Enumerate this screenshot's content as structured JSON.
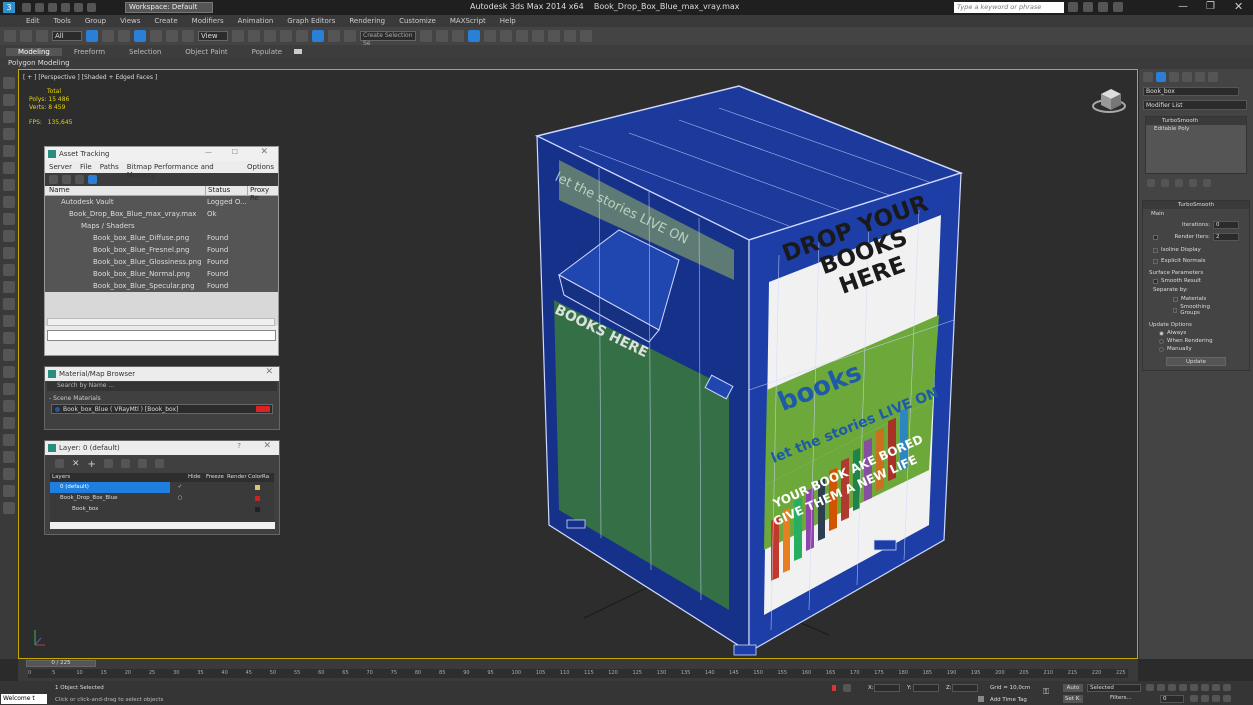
{
  "title": {
    "app": "Autodesk 3ds Max  2014 x64",
    "file": "Book_Drop_Box_Blue_max_vray.max",
    "workspace": "Workspace: Default",
    "search_placeholder": "Type a keyword or phrase"
  },
  "menu": [
    "Edit",
    "Tools",
    "Group",
    "Views",
    "Create",
    "Modifiers",
    "Animation",
    "Graph Editors",
    "Rendering",
    "Customize",
    "MAXScript",
    "Help"
  ],
  "toolbar": {
    "filter": "All",
    "view": "View",
    "selection_set": "Create Selection Se"
  },
  "ribbon": {
    "tabs": [
      "Modeling",
      "Freeform",
      "Selection",
      "Object Paint",
      "Populate"
    ],
    "sub": "Polygon Modeling"
  },
  "viewport": {
    "label": "[ + ] [Perspective ] [Shaded + Edged Faces ]",
    "stats": {
      "total": "Total",
      "polys_label": "Polys:",
      "polys": "15 486",
      "verts_label": "Verts:",
      "verts": "8 459",
      "fps_label": "FPS:",
      "fps": "135,645"
    },
    "sign": {
      "headline1": "DROP YOUR",
      "headline2": "BOOKS HERE",
      "brand": "books",
      "tag1": "let the stories LIVE ON",
      "tag2": "YOUR BOOK AKE BORED",
      "tag3": "GIVE THEM A NEW LIFE",
      "side1": "let the stories LIVE ON",
      "side2": "BOOKS HERE"
    }
  },
  "asset_tracking": {
    "title": "Asset Tracking",
    "menu": [
      "Server",
      "File",
      "Paths",
      "Bitmap Performance and Memory",
      "Options"
    ],
    "columns": [
      "Name",
      "Status",
      "Proxy Re"
    ],
    "rows": [
      {
        "name": "Autodesk Vault",
        "status": "Logged O..."
      },
      {
        "name": "Book_Drop_Box_Blue_max_vray.max",
        "status": "Ok"
      },
      {
        "name": "Maps / Shaders",
        "status": ""
      },
      {
        "name": "Book_box_Blue_Diffuse.png",
        "status": "Found"
      },
      {
        "name": "Book_box_Blue_Fresnel.png",
        "status": "Found"
      },
      {
        "name": "Book_box_Blue_Glossiness.png",
        "status": "Found"
      },
      {
        "name": "Book_box_Blue_Normal.png",
        "status": "Found"
      },
      {
        "name": "Book_box_Blue_Specular.png",
        "status": "Found"
      }
    ]
  },
  "material_browser": {
    "title": "Material/Map Browser",
    "search": "Search by Name ...",
    "group": "- Scene Materials",
    "item": "Book_box_Blue ( VRayMtl ) [Book_box]"
  },
  "layer_panel": {
    "title": "Layer: 0 (default)",
    "columns": [
      "Layers",
      "Hide",
      "Freeze",
      "Render",
      "Color",
      "Ra"
    ],
    "rows": [
      "0 (default)",
      "Book_Drop_Box_Blue",
      "Book_box"
    ]
  },
  "command_panel": {
    "object_name": "Book_box",
    "modifier_list": "Modifier List",
    "stack": [
      "TurboSmooth",
      "Editable Poly"
    ],
    "rollout": "TurboSmooth",
    "main": "Main",
    "iterations_label": "Iterations:",
    "iterations": "0",
    "render_iters_label": "Render Iters:",
    "render_iters": "2",
    "isoline": "Isoline Display",
    "explicit": "Explicit Normals",
    "surface": "Surface Parameters",
    "smooth": "Smooth Result",
    "separate": "Separate by:",
    "materials": "Materials",
    "smoothing_groups": "Smoothing Groups",
    "update_options": "Update Options",
    "always": "Always",
    "when_rendering": "When Rendering",
    "manually": "Manually",
    "update": "Update"
  },
  "timeline": {
    "frame": "0 / 225",
    "ticks": [
      "0",
      "5",
      "10",
      "15",
      "20",
      "25",
      "30",
      "35",
      "40",
      "45",
      "50",
      "55",
      "60",
      "65",
      "70",
      "75",
      "80",
      "85",
      "90",
      "95",
      "100",
      "105",
      "110",
      "115",
      "120",
      "125",
      "130",
      "135",
      "140",
      "145",
      "150",
      "155",
      "160",
      "165",
      "170",
      "175",
      "180",
      "185",
      "190",
      "195",
      "200",
      "205",
      "210",
      "215",
      "220",
      "225"
    ]
  },
  "status": {
    "welcome": "Welcome t",
    "selected": "1 Object Selected",
    "hint": "Click or click-and-drag to select objects",
    "x": "X:",
    "y": "Y:",
    "z": "Z:",
    "grid": "Grid = 10,0cm",
    "auto": "Auto",
    "selected_dd": "Selected",
    "set_k": "Set K.",
    "filters": "Filters...",
    "add_time_tag": "Add Time Tag",
    "frame": "0"
  }
}
